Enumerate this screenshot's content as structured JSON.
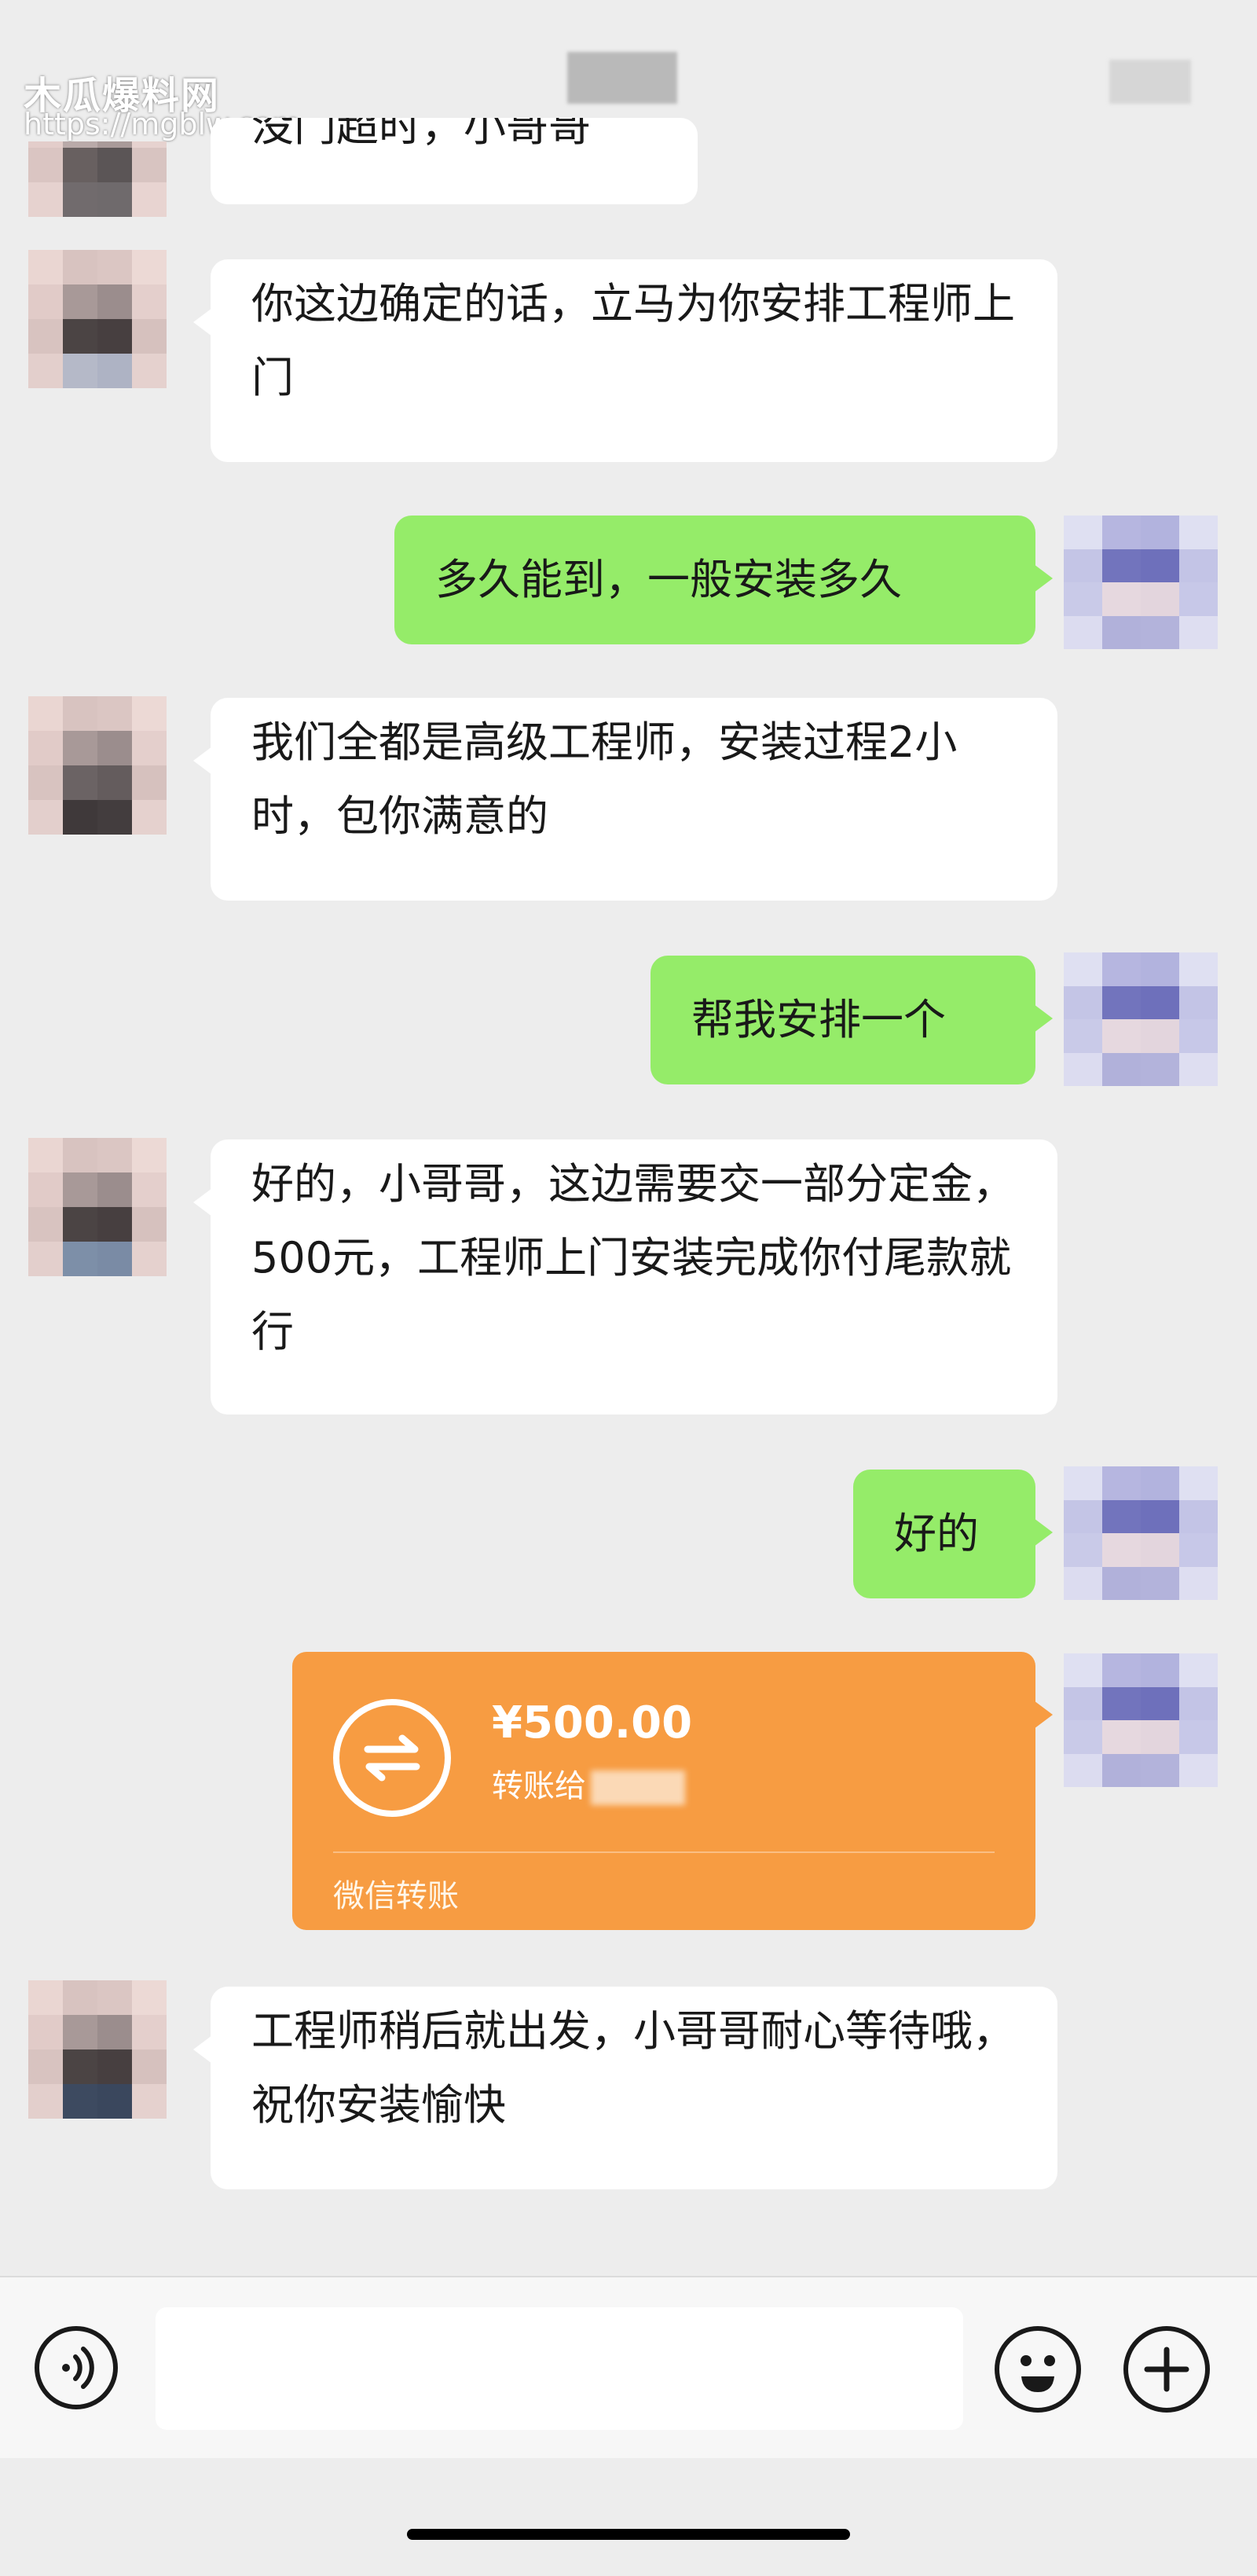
{
  "watermark": {
    "title": "木瓜爆料网",
    "url": "https://mgblw.com"
  },
  "messages": [
    {
      "side": "left",
      "text": "没门超时，小哥哥"
    },
    {
      "side": "left",
      "text": "你这边确定的话，立马为你安排工程师上门"
    },
    {
      "side": "right",
      "text": "多久能到，一般安装多久"
    },
    {
      "side": "left",
      "text": "我们全都是高级工程师，安装过程2小时，包你满意的"
    },
    {
      "side": "right",
      "text": "帮我安排一个"
    },
    {
      "side": "left",
      "text": "好的，小哥哥，这边需要交一部分定金，500元，工程师上门安装完成你付尾款就行"
    },
    {
      "side": "right",
      "text": "好的"
    },
    {
      "side": "left",
      "text": "工程师稍后就出发，小哥哥耐心等待哦，祝你安装愉快"
    }
  ],
  "transfer": {
    "amount": "¥500.00",
    "desc": "转账给",
    "label": "微信转账",
    "icon": "transfer-arrows-icon",
    "color": "#f79c42"
  },
  "input_bar": {
    "voice_icon": "voice-icon",
    "emoji_icon": "emoji-icon",
    "plus_icon": "plus-icon"
  },
  "colors": {
    "background": "#ededed",
    "left_bubble": "#ffffff",
    "right_bubble": "#95ec69"
  }
}
